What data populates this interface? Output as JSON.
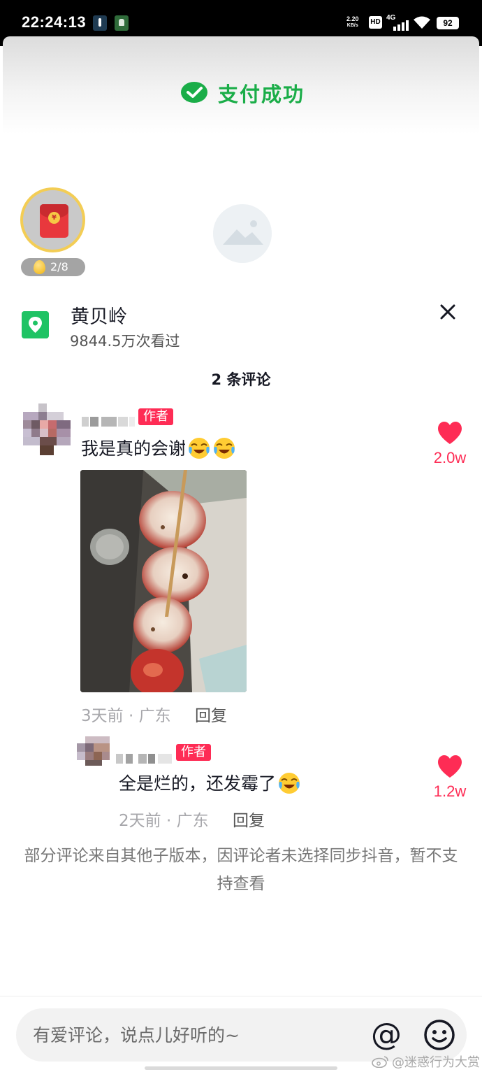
{
  "status_bar": {
    "time": "22:24:13",
    "net_speed_value": "2.20",
    "net_speed_unit": "KB/s",
    "hd_label": "HD",
    "network_label": "4G",
    "battery": "92"
  },
  "video": {
    "payment_status": "支付成功",
    "egg_progress": "2/8"
  },
  "location": {
    "title": "黄贝岭",
    "views": "9844.5万次看过"
  },
  "comments_header": "2 条评论",
  "comments": [
    {
      "author_tag": "作者",
      "text": "我是真的会谢",
      "emoji": [
        "crying-laughing-emoji",
        "crying-laughing-emoji"
      ],
      "meta": "3天前 · 广东",
      "reply_label": "回复",
      "likes": "2.0w"
    },
    {
      "author_tag": "作者",
      "text": "全是烂的，还发霉了",
      "emoji": [
        "crying-laughing-emoji"
      ],
      "meta": "2天前 · 广东",
      "reply_label": "回复",
      "likes": "1.2w"
    }
  ],
  "notice": "部分评论来自其他子版本，因评论者未选择同步抖音，暂不支持查看",
  "input": {
    "placeholder": "有爱评论，说点儿好听的~",
    "at_symbol": "@"
  },
  "watermark": "@迷惑行为大赏",
  "colors": {
    "accent_pink": "#fe2c55",
    "wechat_green": "#1aad48",
    "location_green": "#1fc364"
  }
}
